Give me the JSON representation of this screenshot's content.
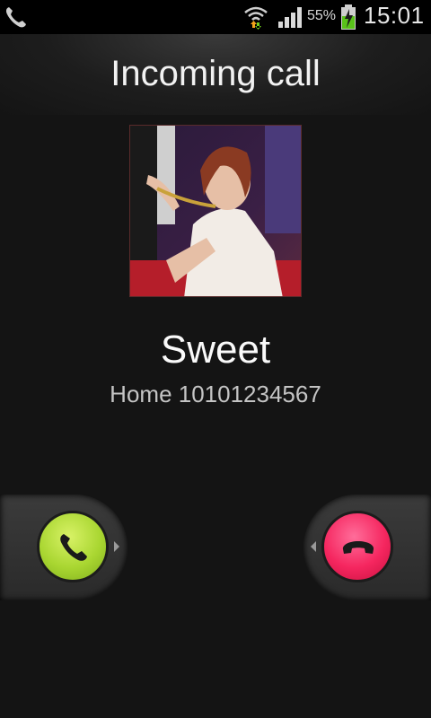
{
  "status_bar": {
    "battery_percent": "55%",
    "time": "15:01",
    "icons": [
      "phone-icon",
      "wifi-icon",
      "signal-icon",
      "battery-charging-icon"
    ]
  },
  "call": {
    "state": "Incoming call",
    "contact_name": "Sweet",
    "number_label": "Home 10101234567"
  },
  "actions": {
    "answer_icon": "answer-phone-icon",
    "decline_icon": "decline-phone-icon",
    "answer_color": "#a9d631",
    "decline_color": "#f5265f"
  }
}
